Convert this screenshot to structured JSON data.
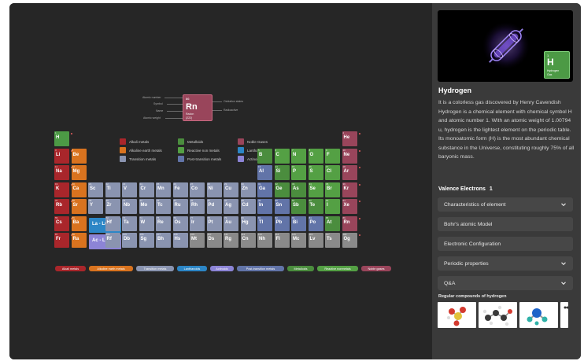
{
  "element": {
    "symbol": "H",
    "name": "Hydrogen",
    "number": "1",
    "state": "Gas",
    "description": "It is a colorless gas discovered by Henry Cavendish",
    "details": "Hydrogen is a chemical element with chemical symbol H and atomic number 1. With an atomic weight of 1.00794 u, hydrogen is the lightest element on the periodic table. Its monoatomic form (H) is the most abundant chemical substance in the Universe, constituting roughly 75% of all baryonic mass.",
    "valence_label": "Valence Electrons",
    "valence_value": "1"
  },
  "accordion": [
    {
      "label": "Characteristics of element",
      "expandable": true
    },
    {
      "label": "Bohr's atomic Model",
      "expandable": false
    },
    {
      "label": "Electronic Configuration",
      "expandable": false
    },
    {
      "label": "Periodic properties",
      "expandable": true
    },
    {
      "label": "Q&A",
      "expandable": true
    }
  ],
  "compounds": {
    "title": "Regular compounds of hydrogen",
    "items": [
      "compound-1",
      "compound-2",
      "compound-3",
      "compound-4"
    ]
  },
  "key": {
    "number": "86",
    "symbol": "Rn",
    "name": "Radon",
    "mass": "(222)",
    "left_labels": [
      "Atomic number",
      "Symbol",
      "Name",
      "Atomic weight"
    ],
    "right_labels": [
      "Oxidation states",
      "Radioactive"
    ]
  },
  "legend": [
    {
      "label": "Alkali metals",
      "color": "#a9262b"
    },
    {
      "label": "Alkaline earth metals",
      "color": "#d9731f"
    },
    {
      "label": "Transition metals",
      "color": "#8a94b0"
    },
    {
      "label": "Metalloids",
      "color": "#4b8d3e"
    },
    {
      "label": "Reactive non metals",
      "color": "#54a044"
    },
    {
      "label": "Post-transition metals",
      "color": "#6274a8"
    },
    {
      "label": "Noble Gases",
      "color": "#99455b"
    },
    {
      "label": "Lanthanoids",
      "color": "#2c86c6"
    },
    {
      "label": "Actinoids",
      "color": "#8c84d6"
    }
  ],
  "pills": [
    {
      "label": "Alkali metals",
      "color": "#a9262b"
    },
    {
      "label": "Alkaline earth metals",
      "color": "#d9731f"
    },
    {
      "label": "Transition metals",
      "color": "#8a94b0"
    },
    {
      "label": "Lanthanoids",
      "color": "#2c86c6"
    },
    {
      "label": "Actinoids",
      "color": "#8c84d6"
    },
    {
      "label": "Post-transition metals",
      "color": "#6274a8"
    },
    {
      "label": "Metalloids",
      "color": "#4b8d3e"
    },
    {
      "label": "Reactive nonmetals",
      "color": "#54a044"
    },
    {
      "label": "Noble gases",
      "color": "#99455b"
    }
  ],
  "lanthanides_label": "La - Lu",
  "actinides_label": "Ac - Lr",
  "elements": [
    {
      "s": "H",
      "n": 1,
      "r": 1,
      "c": 1,
      "cat": "h"
    },
    {
      "s": "He",
      "n": 2,
      "r": 1,
      "c": 18,
      "cat": "noble"
    },
    {
      "s": "Li",
      "n": 3,
      "r": 2,
      "c": 1,
      "cat": "alkali"
    },
    {
      "s": "Be",
      "n": 4,
      "r": 2,
      "c": 2,
      "cat": "earth"
    },
    {
      "s": "B",
      "n": 5,
      "r": 2,
      "c": 13,
      "cat": "metalloid"
    },
    {
      "s": "C",
      "n": 6,
      "r": 2,
      "c": 14,
      "cat": "reactive"
    },
    {
      "s": "N",
      "n": 7,
      "r": 2,
      "c": 15,
      "cat": "reactive"
    },
    {
      "s": "O",
      "n": 8,
      "r": 2,
      "c": 16,
      "cat": "reactive"
    },
    {
      "s": "F",
      "n": 9,
      "r": 2,
      "c": 17,
      "cat": "reactive"
    },
    {
      "s": "Ne",
      "n": 10,
      "r": 2,
      "c": 18,
      "cat": "noble"
    },
    {
      "s": "Na",
      "n": 11,
      "r": 3,
      "c": 1,
      "cat": "alkali"
    },
    {
      "s": "Mg",
      "n": 12,
      "r": 3,
      "c": 2,
      "cat": "earth"
    },
    {
      "s": "Al",
      "n": 13,
      "r": 3,
      "c": 13,
      "cat": "post"
    },
    {
      "s": "Si",
      "n": 14,
      "r": 3,
      "c": 14,
      "cat": "metalloid"
    },
    {
      "s": "P",
      "n": 15,
      "r": 3,
      "c": 15,
      "cat": "reactive"
    },
    {
      "s": "S",
      "n": 16,
      "r": 3,
      "c": 16,
      "cat": "reactive"
    },
    {
      "s": "Cl",
      "n": 17,
      "r": 3,
      "c": 17,
      "cat": "reactive"
    },
    {
      "s": "Ar",
      "n": 18,
      "r": 3,
      "c": 18,
      "cat": "noble"
    },
    {
      "s": "K",
      "n": 19,
      "r": 4,
      "c": 1,
      "cat": "alkali"
    },
    {
      "s": "Ca",
      "n": 20,
      "r": 4,
      "c": 2,
      "cat": "earth"
    },
    {
      "s": "Sc",
      "n": 21,
      "r": 4,
      "c": 3,
      "cat": "trans"
    },
    {
      "s": "Ti",
      "n": 22,
      "r": 4,
      "c": 4,
      "cat": "trans"
    },
    {
      "s": "V",
      "n": 23,
      "r": 4,
      "c": 5,
      "cat": "trans"
    },
    {
      "s": "Cr",
      "n": 24,
      "r": 4,
      "c": 6,
      "cat": "trans"
    },
    {
      "s": "Mn",
      "n": 25,
      "r": 4,
      "c": 7,
      "cat": "trans"
    },
    {
      "s": "Fe",
      "n": 26,
      "r": 4,
      "c": 8,
      "cat": "trans"
    },
    {
      "s": "Co",
      "n": 27,
      "r": 4,
      "c": 9,
      "cat": "trans"
    },
    {
      "s": "Ni",
      "n": 28,
      "r": 4,
      "c": 10,
      "cat": "trans"
    },
    {
      "s": "Cu",
      "n": 29,
      "r": 4,
      "c": 11,
      "cat": "trans"
    },
    {
      "s": "Zn",
      "n": 30,
      "r": 4,
      "c": 12,
      "cat": "trans"
    },
    {
      "s": "Ga",
      "n": 31,
      "r": 4,
      "c": 13,
      "cat": "post"
    },
    {
      "s": "Ge",
      "n": 32,
      "r": 4,
      "c": 14,
      "cat": "metalloid"
    },
    {
      "s": "As",
      "n": 33,
      "r": 4,
      "c": 15,
      "cat": "metalloid"
    },
    {
      "s": "Se",
      "n": 34,
      "r": 4,
      "c": 16,
      "cat": "reactive"
    },
    {
      "s": "Br",
      "n": 35,
      "r": 4,
      "c": 17,
      "cat": "reactive"
    },
    {
      "s": "Kr",
      "n": 36,
      "r": 4,
      "c": 18,
      "cat": "noble"
    },
    {
      "s": "Rb",
      "n": 37,
      "r": 5,
      "c": 1,
      "cat": "alkali"
    },
    {
      "s": "Sr",
      "n": 38,
      "r": 5,
      "c": 2,
      "cat": "earth"
    },
    {
      "s": "Y",
      "n": 39,
      "r": 5,
      "c": 3,
      "cat": "trans"
    },
    {
      "s": "Zr",
      "n": 40,
      "r": 5,
      "c": 4,
      "cat": "trans"
    },
    {
      "s": "Nb",
      "n": 41,
      "r": 5,
      "c": 5,
      "cat": "trans"
    },
    {
      "s": "Mo",
      "n": 42,
      "r": 5,
      "c": 6,
      "cat": "trans"
    },
    {
      "s": "Tc",
      "n": 43,
      "r": 5,
      "c": 7,
      "cat": "trans"
    },
    {
      "s": "Ru",
      "n": 44,
      "r": 5,
      "c": 8,
      "cat": "trans"
    },
    {
      "s": "Rh",
      "n": 45,
      "r": 5,
      "c": 9,
      "cat": "trans"
    },
    {
      "s": "Pd",
      "n": 46,
      "r": 5,
      "c": 10,
      "cat": "trans"
    },
    {
      "s": "Ag",
      "n": 47,
      "r": 5,
      "c": 11,
      "cat": "trans"
    },
    {
      "s": "Cd",
      "n": 48,
      "r": 5,
      "c": 12,
      "cat": "trans"
    },
    {
      "s": "In",
      "n": 49,
      "r": 5,
      "c": 13,
      "cat": "post"
    },
    {
      "s": "Sn",
      "n": 50,
      "r": 5,
      "c": 14,
      "cat": "post"
    },
    {
      "s": "Sb",
      "n": 51,
      "r": 5,
      "c": 15,
      "cat": "metalloid"
    },
    {
      "s": "Te",
      "n": 52,
      "r": 5,
      "c": 16,
      "cat": "metalloid"
    },
    {
      "s": "I",
      "n": 53,
      "r": 5,
      "c": 17,
      "cat": "reactive"
    },
    {
      "s": "Xe",
      "n": 54,
      "r": 5,
      "c": 18,
      "cat": "noble"
    },
    {
      "s": "Cs",
      "n": 55,
      "r": 6,
      "c": 1,
      "cat": "alkali"
    },
    {
      "s": "Ba",
      "n": 56,
      "r": 6,
      "c": 2,
      "cat": "earth"
    },
    {
      "s": "Hf",
      "n": 72,
      "r": 6,
      "c": 4,
      "cat": "trans"
    },
    {
      "s": "Ta",
      "n": 73,
      "r": 6,
      "c": 5,
      "cat": "trans"
    },
    {
      "s": "W",
      "n": 74,
      "r": 6,
      "c": 6,
      "cat": "trans"
    },
    {
      "s": "Re",
      "n": 75,
      "r": 6,
      "c": 7,
      "cat": "trans"
    },
    {
      "s": "Os",
      "n": 76,
      "r": 6,
      "c": 8,
      "cat": "trans"
    },
    {
      "s": "Ir",
      "n": 77,
      "r": 6,
      "c": 9,
      "cat": "trans"
    },
    {
      "s": "Pt",
      "n": 78,
      "r": 6,
      "c": 10,
      "cat": "trans"
    },
    {
      "s": "Au",
      "n": 79,
      "r": 6,
      "c": 11,
      "cat": "trans"
    },
    {
      "s": "Hg",
      "n": 80,
      "r": 6,
      "c": 12,
      "cat": "trans"
    },
    {
      "s": "Tl",
      "n": 81,
      "r": 6,
      "c": 13,
      "cat": "post"
    },
    {
      "s": "Pb",
      "n": 82,
      "r": 6,
      "c": 14,
      "cat": "post"
    },
    {
      "s": "Bi",
      "n": 83,
      "r": 6,
      "c": 15,
      "cat": "post"
    },
    {
      "s": "Po",
      "n": 84,
      "r": 6,
      "c": 16,
      "cat": "post"
    },
    {
      "s": "At",
      "n": 85,
      "r": 6,
      "c": 17,
      "cat": "metalloid"
    },
    {
      "s": "Rn",
      "n": 86,
      "r": 6,
      "c": 18,
      "cat": "noble"
    },
    {
      "s": "Fr",
      "n": 87,
      "r": 7,
      "c": 1,
      "cat": "alkali"
    },
    {
      "s": "Ra",
      "n": 88,
      "r": 7,
      "c": 2,
      "cat": "earth"
    },
    {
      "s": "Rf",
      "n": 104,
      "r": 7,
      "c": 4,
      "cat": "trans"
    },
    {
      "s": "Db",
      "n": 105,
      "r": 7,
      "c": 5,
      "cat": "trans"
    },
    {
      "s": "Sg",
      "n": 106,
      "r": 7,
      "c": 6,
      "cat": "trans"
    },
    {
      "s": "Bh",
      "n": 107,
      "r": 7,
      "c": 7,
      "cat": "trans"
    },
    {
      "s": "Hs",
      "n": 108,
      "r": 7,
      "c": 8,
      "cat": "trans"
    },
    {
      "s": "Mt",
      "n": 109,
      "r": 7,
      "c": 9,
      "cat": "unknown"
    },
    {
      "s": "Ds",
      "n": 110,
      "r": 7,
      "c": 10,
      "cat": "unknown"
    },
    {
      "s": "Rg",
      "n": 111,
      "r": 7,
      "c": 11,
      "cat": "unknown"
    },
    {
      "s": "Cn",
      "n": 112,
      "r": 7,
      "c": 12,
      "cat": "unknown"
    },
    {
      "s": "Nh",
      "n": 113,
      "r": 7,
      "c": 13,
      "cat": "unknown"
    },
    {
      "s": "Fl",
      "n": 114,
      "r": 7,
      "c": 14,
      "cat": "unknown"
    },
    {
      "s": "Mc",
      "n": 115,
      "r": 7,
      "c": 15,
      "cat": "unknown"
    },
    {
      "s": "Lv",
      "n": 116,
      "r": 7,
      "c": 16,
      "cat": "unknown"
    },
    {
      "s": "Ts",
      "n": 117,
      "r": 7,
      "c": 17,
      "cat": "unknown"
    },
    {
      "s": "Og",
      "n": 118,
      "r": 7,
      "c": 18,
      "cat": "unknown"
    }
  ]
}
